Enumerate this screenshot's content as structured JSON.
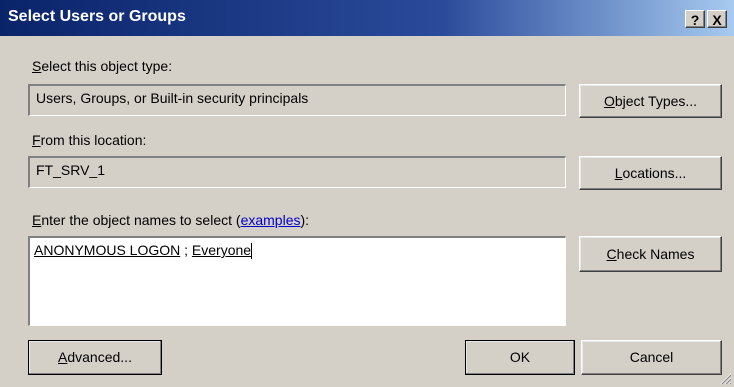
{
  "window": {
    "title": "Select Users or Groups",
    "help_glyph": "?",
    "close_glyph": "X"
  },
  "object_type": {
    "label_accel": "S",
    "label_rest": "elect this object type:",
    "value": "Users, Groups, or Built-in security principals",
    "button_accel": "O",
    "button_rest": "bject Types..."
  },
  "location": {
    "label_accel": "F",
    "label_rest": "rom this location:",
    "value": "FT_SRV_1",
    "button_accel": "L",
    "button_rest": "ocations..."
  },
  "names": {
    "label_accel": "E",
    "label_rest": "nter the object names to select (",
    "label_link": "examples",
    "label_end": "):",
    "entries": [
      "ANONYMOUS LOGON",
      "Everyone"
    ],
    "separator": " ; ",
    "check_accel": "C",
    "check_rest": "heck Names"
  },
  "footer": {
    "advanced_accel": "A",
    "advanced_rest": "dvanced...",
    "ok_label": "OK",
    "cancel_label": "Cancel"
  }
}
